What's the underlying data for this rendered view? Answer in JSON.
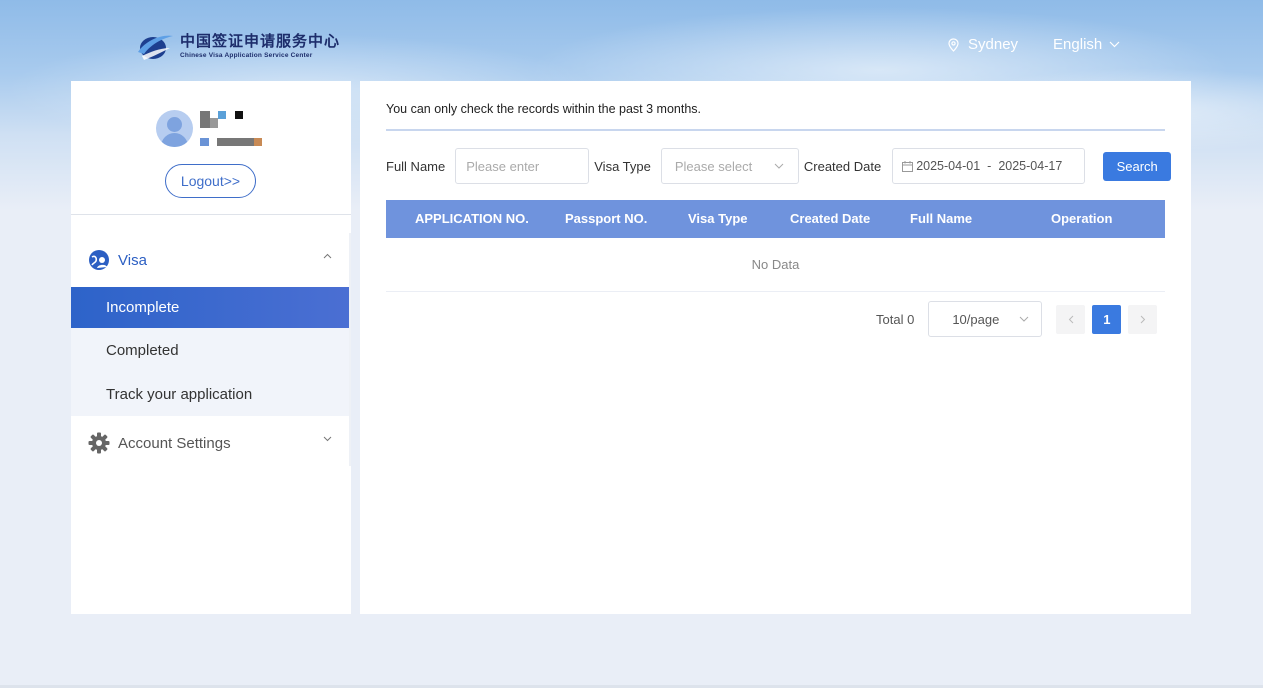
{
  "header": {
    "logo_cn": "中国签证申请服务中心",
    "logo_en": "Chinese Visa Application Service Center",
    "location": "Sydney",
    "language": "English"
  },
  "sidebar": {
    "logout_label": "Logout>>",
    "visa_menu": {
      "label": "Visa",
      "icon": "globe-user-icon",
      "items": [
        {
          "label": "Incomplete",
          "active": true
        },
        {
          "label": "Completed",
          "active": false
        },
        {
          "label": "Track your application",
          "active": false
        }
      ]
    },
    "account_menu": {
      "label": "Account Settings",
      "icon": "gear-icon"
    }
  },
  "main": {
    "notice": "You can only check the records within the past 3 months.",
    "filters": {
      "full_name_label": "Full Name",
      "full_name_placeholder": "Please enter",
      "visa_type_label": "Visa Type",
      "visa_type_placeholder": "Please select",
      "created_date_label": "Created Date",
      "date_from": "2025-04-01",
      "date_sep": "-",
      "date_to": "2025-04-17",
      "search_label": "Search"
    },
    "table": {
      "columns": [
        "APPLICATION NO.",
        "Passport NO.",
        "Visa Type",
        "Created Date",
        "Full Name",
        "Operation"
      ],
      "empty_text": "No Data"
    },
    "pagination": {
      "total": "Total 0",
      "page_size": "10/page",
      "current_page": "1"
    }
  },
  "colors": {
    "primary": "#3a7ae0",
    "table_header": "#6f93dd",
    "active_menu": "#2d63c9"
  }
}
